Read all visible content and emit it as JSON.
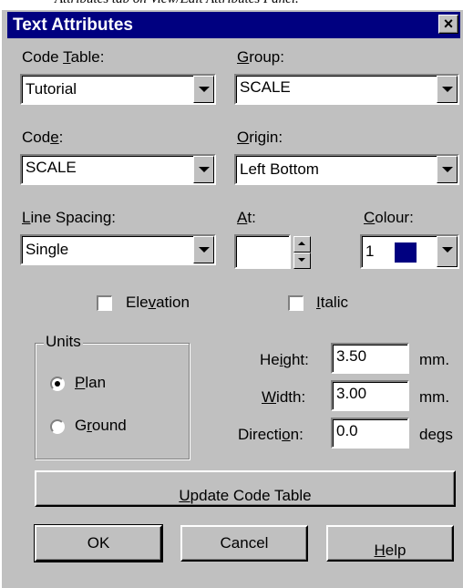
{
  "page_header_fragment": "Attributes tab on View/Edit Attributes Panel.",
  "window": {
    "title": "Text Attributes",
    "close_glyph": "×"
  },
  "fields": {
    "code_table": {
      "label_pre": "Code ",
      "label_ul": "T",
      "label_post": "able:",
      "value": "Tutorial"
    },
    "group": {
      "label_pre": "",
      "label_ul": "G",
      "label_post": "roup:",
      "value": "SCALE"
    },
    "code": {
      "label_pre": "Cod",
      "label_ul": "e",
      "label_post": ":",
      "value": "SCALE"
    },
    "origin": {
      "label_pre": "",
      "label_ul": "O",
      "label_post": "rigin:",
      "value": "Left Bottom"
    },
    "line_spacing": {
      "label_pre": "",
      "label_ul": "L",
      "label_post": "ine Spacing:",
      "value": "Single"
    },
    "at": {
      "label_pre": "",
      "label_ul": "A",
      "label_post": "t:",
      "value": ""
    },
    "colour": {
      "label_pre": "",
      "label_ul": "C",
      "label_post": "olour:",
      "value": "1",
      "swatch_color": "#000080"
    }
  },
  "checkboxes": {
    "elevation": {
      "label_pre": "Ele",
      "label_ul": "v",
      "label_post": "ation",
      "checked": false
    },
    "italic": {
      "label_pre": "",
      "label_ul": "I",
      "label_post": "talic",
      "checked": false
    }
  },
  "units": {
    "legend": "Units",
    "plan": {
      "label_pre": "",
      "label_ul": "P",
      "label_post": "lan",
      "checked": true
    },
    "ground": {
      "label_pre": "G",
      "label_ul": "r",
      "label_post": "ound",
      "checked": false
    }
  },
  "dimensions": {
    "height": {
      "label_pre": "He",
      "label_ul": "i",
      "label_post": "ght:",
      "value": "3.50",
      "unit": "mm."
    },
    "width": {
      "label_pre": "",
      "label_ul": "W",
      "label_post": "idth:",
      "value": "3.00",
      "unit": "mm."
    },
    "direction": {
      "label_pre": "Directi",
      "label_ul": "o",
      "label_post": "n:",
      "value": "0.0",
      "unit": "degs"
    }
  },
  "buttons": {
    "update": {
      "label_pre": "",
      "label_ul": "U",
      "label_post": "pdate Code Table"
    },
    "ok": {
      "label": "OK"
    },
    "cancel": {
      "label": "Cancel"
    },
    "help": {
      "label_pre": "",
      "label_ul": "H",
      "label_post": "elp"
    }
  }
}
